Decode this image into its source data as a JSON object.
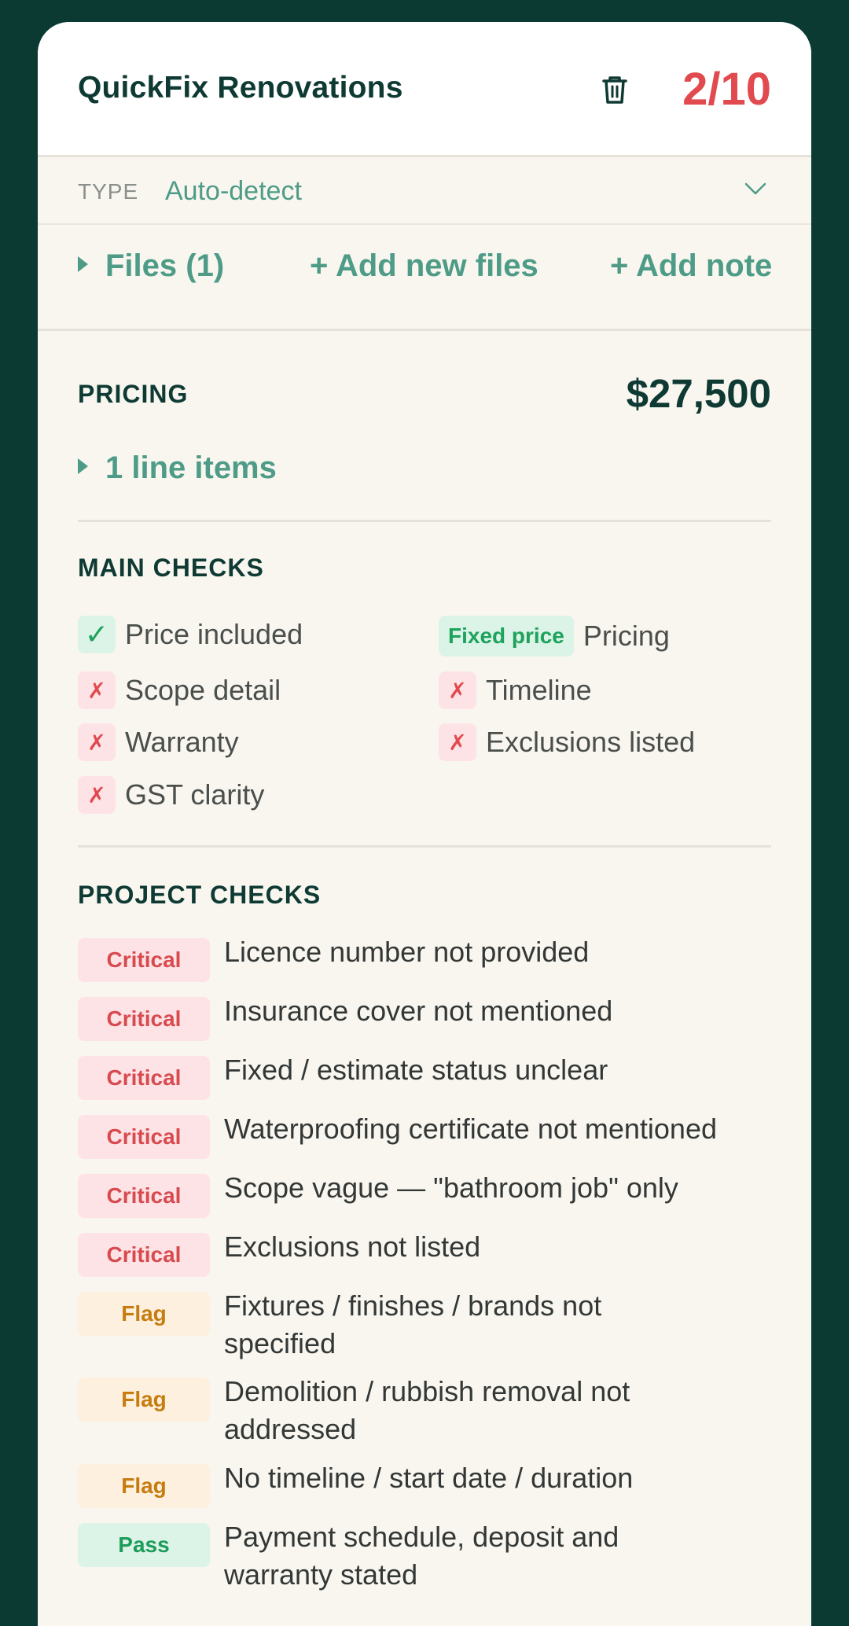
{
  "header": {
    "title": "QuickFix Renovations",
    "score": "2/10",
    "trash_icon": "trash-icon",
    "score_color": "#e14a4f"
  },
  "type": {
    "label": "TYPE",
    "value": "Auto-detect",
    "chevron_icon": "chevron-down-icon"
  },
  "files": {
    "files_label": "Files (1)",
    "add_files_label": "+ Add new files",
    "add_note_label": "+ Add note"
  },
  "pricing": {
    "title": "PRICING",
    "total": "$27,500",
    "line_items_label": "1 line items"
  },
  "main_checks": {
    "title": "MAIN CHECKS",
    "items": [
      {
        "label": "Price included",
        "status": "pass"
      },
      {
        "label": "Pricing",
        "badge": "Fixed price"
      },
      {
        "label": "Scope detail",
        "status": "fail"
      },
      {
        "label": "Timeline",
        "status": "fail"
      },
      {
        "label": "Warranty",
        "status": "fail"
      },
      {
        "label": "Exclusions listed",
        "status": "fail"
      },
      {
        "label": "GST clarity",
        "status": "fail"
      }
    ],
    "pass_glyph": "✓",
    "fail_glyph": "✗"
  },
  "project_checks": {
    "title": "PROJECT CHECKS",
    "rows": [
      {
        "severity": "Critical",
        "text": "Licence number not provided"
      },
      {
        "severity": "Critical",
        "text": "Insurance cover not mentioned"
      },
      {
        "severity": "Critical",
        "text": "Fixed / estimate status unclear"
      },
      {
        "severity": "Critical",
        "text": "Waterproofing certificate not mentioned"
      },
      {
        "severity": "Critical",
        "text": "Scope vague — \"bathroom job\" only"
      },
      {
        "severity": "Critical",
        "text": "Exclusions not listed"
      },
      {
        "severity": "Flag",
        "text": "Fixtures / finishes / brands not specified"
      },
      {
        "severity": "Flag",
        "text": "Demolition / rubbish removal not addressed"
      },
      {
        "severity": "Flag",
        "text": "No timeline / start date / duration"
      },
      {
        "severity": "Pass",
        "text": "Payment schedule, deposit and warranty stated"
      }
    ]
  },
  "colors": {
    "background": "#0b3a33",
    "accent": "#4e9c87",
    "critical": "#d84a4f",
    "flag": "#c67c0f",
    "pass": "#1d9c5a"
  }
}
